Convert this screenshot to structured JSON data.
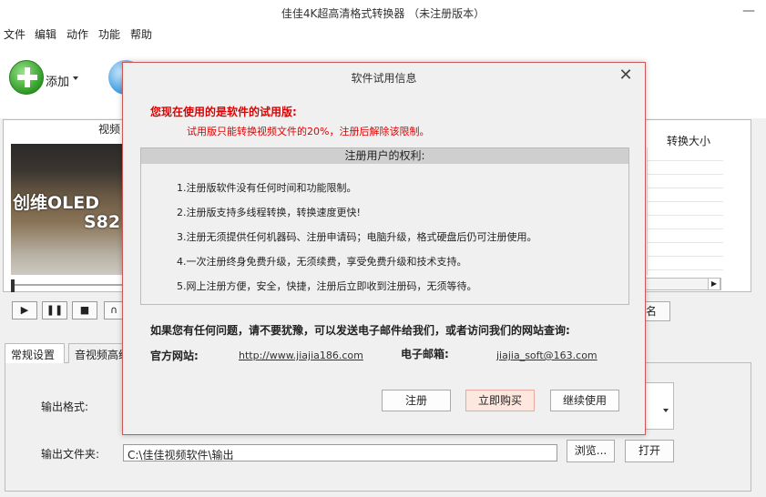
{
  "window": {
    "title": "佳佳4K超高清格式转换器 （未注册版本）",
    "minimize_glyph": "—"
  },
  "menu": [
    "文件",
    "编辑",
    "动作",
    "功能",
    "帮助"
  ],
  "toolbar": {
    "add_label": "添加"
  },
  "file_list": {
    "video_header": "视频",
    "size_header": "转换大小",
    "thumb_text_1": "创维OLED",
    "thumb_text_2": "S82",
    "rename_label": "名"
  },
  "player": {
    "play": "▶",
    "pause": "❚❚",
    "stop": "■",
    "loop": "∩"
  },
  "tabs": [
    "常规设置",
    "音视频高级"
  ],
  "settings": {
    "format_label": "输出格式:",
    "folder_label": "输出文件夹:",
    "folder_value": "C:\\佳佳视频软件\\输出",
    "browse_label": "浏览...",
    "open_label": "打开"
  },
  "dialog": {
    "title": "软件试用信息",
    "close_glyph": "✕",
    "warn_title": "您现在使用的是软件的试用版:",
    "warn_detail": "试用版只能转换视频文件的20%，注册后解除该限制。",
    "rights_header": "注册用户的权利:",
    "rights": [
      "1.注册版软件没有任何时间和功能限制。",
      "2.注册版支持多线程转换，转换速度更快!",
      "3.注册无须提供任何机器码、注册申请码；电脑升级，格式硬盘后仍可注册使用。",
      "4.一次注册终身免费升级，无须续费，享受免费升级和技术支持。",
      "5.网上注册方便，安全，快捷，注册后立即收到注册码，无须等待。"
    ],
    "question": "如果您有任何问题，请不要犹豫，可以发送电子邮件给我们，或者访问我们的网站查询:",
    "site_label": "官方网站:",
    "site_url": "http://www.jiajia186.com",
    "email_label": "电子邮箱:",
    "email": "jiajia_soft@163.com",
    "buttons": {
      "register": "注册",
      "buy": "立即购买",
      "continue": "继续使用"
    }
  }
}
